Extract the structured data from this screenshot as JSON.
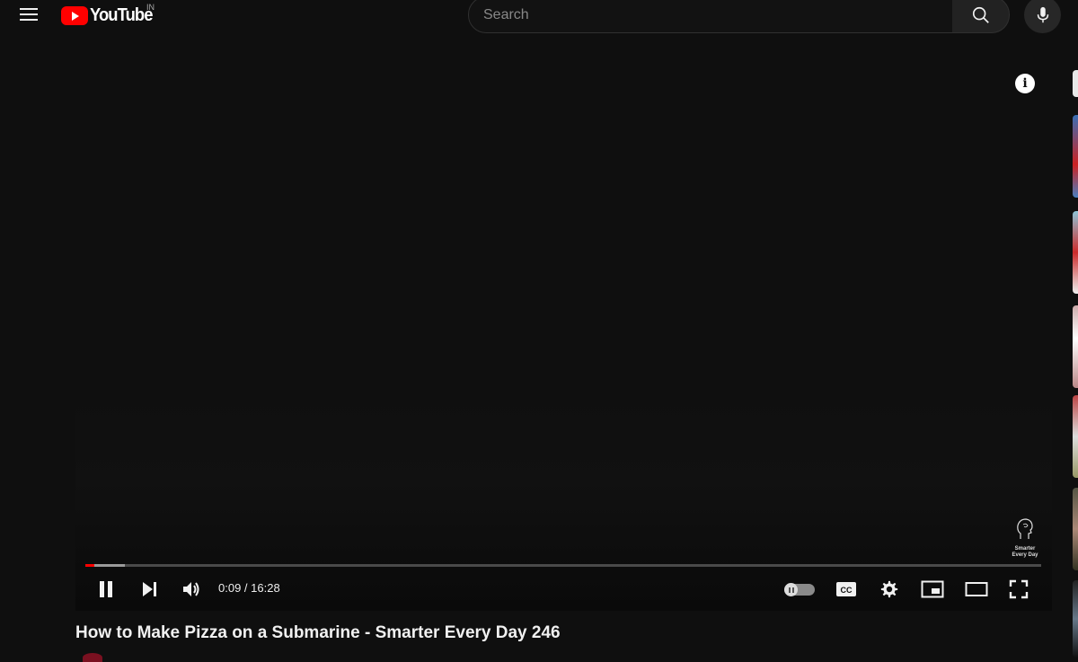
{
  "header": {
    "logo_text": "YouTube",
    "country_code": "IN",
    "search_placeholder": "Search"
  },
  "player": {
    "current_time": "0:09",
    "duration": "16:28",
    "time_display": "0:09 / 16:28",
    "progress_played_fraction": 0.009,
    "progress_buffered_fraction": 0.041,
    "watermark_text": "Smarter Every Day",
    "autoplay_on": false
  },
  "video": {
    "title": "How to Make Pizza on a Submarine - Smarter Every Day 246"
  },
  "icons": [
    "menu-icon",
    "youtube-logo-icon",
    "search-icon",
    "mic-icon",
    "info-icon",
    "pause-icon",
    "next-icon",
    "volume-icon",
    "autoplay-icon",
    "captions-icon",
    "settings-icon",
    "miniplayer-icon",
    "theater-icon",
    "fullscreen-icon"
  ],
  "colors": {
    "background": "#0f0f0f",
    "brand_red": "#ff0000",
    "text": "#f1f1f1"
  }
}
